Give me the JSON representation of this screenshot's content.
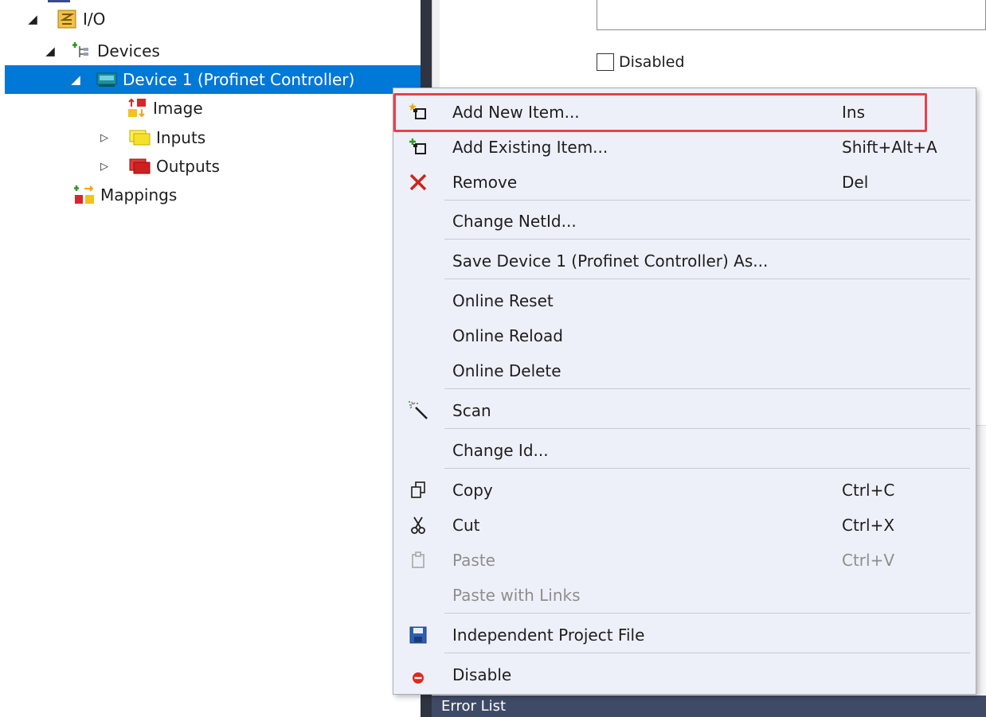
{
  "tree": {
    "io_label": "I/O",
    "devices_label": "Devices",
    "device1_label": "Device 1 (Profinet Controller)",
    "image_label": "Image",
    "inputs_label": "Inputs",
    "outputs_label": "Outputs",
    "mappings_label": "Mappings"
  },
  "properties": {
    "disabled_label": "Disabled",
    "disabled_checked": false
  },
  "context_menu": {
    "add_new_item": {
      "label": "Add New Item...",
      "shortcut": "Ins"
    },
    "add_existing_item": {
      "label": "Add Existing Item...",
      "shortcut": "Shift+Alt+A"
    },
    "remove": {
      "label": "Remove",
      "shortcut": "Del"
    },
    "change_netid": {
      "label": "Change NetId..."
    },
    "save_as": {
      "label": "Save Device 1 (Profinet Controller) As..."
    },
    "online_reset": {
      "label": "Online Reset"
    },
    "online_reload": {
      "label": "Online Reload"
    },
    "online_delete": {
      "label": "Online Delete"
    },
    "scan": {
      "label": "Scan"
    },
    "change_id": {
      "label": "Change Id..."
    },
    "copy": {
      "label": "Copy",
      "shortcut": "Ctrl+C"
    },
    "cut": {
      "label": "Cut",
      "shortcut": "Ctrl+X"
    },
    "paste": {
      "label": "Paste",
      "shortcut": "Ctrl+V"
    },
    "paste_with_links": {
      "label": "Paste with Links"
    },
    "independent_project_file": {
      "label": "Independent Project File"
    },
    "disable": {
      "label": "Disable"
    }
  },
  "bottom_panel": {
    "title": "Error List"
  },
  "colors": {
    "selection": "#0078d7",
    "menu_background": "#eef0f9",
    "highlight_border": "#e8414b",
    "error_bar": "#3f4b66"
  }
}
